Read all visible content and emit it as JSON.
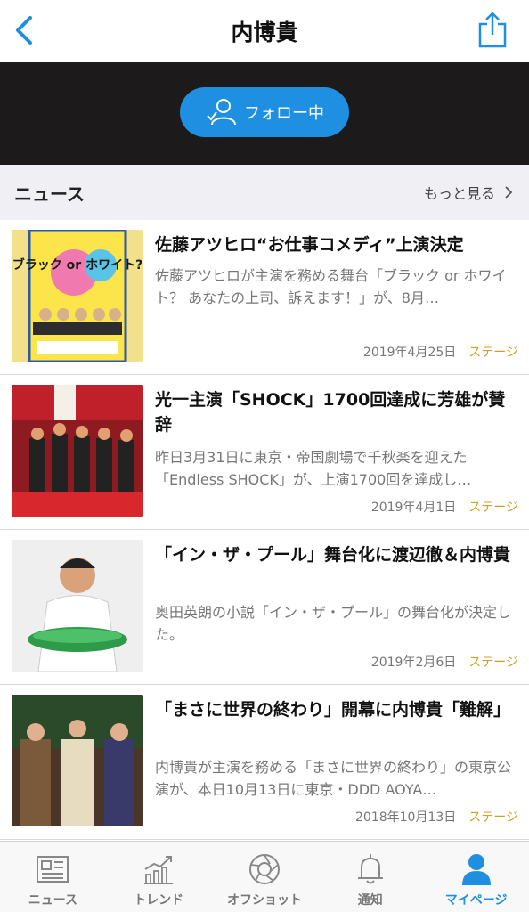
{
  "header": {
    "title": "内博貴"
  },
  "follow": {
    "label": "フォロー中"
  },
  "news_section": {
    "label": "ニュース",
    "more": "もっと見る"
  },
  "articles": [
    {
      "title": "佐藤アツヒロ“お仕事コメディ”上演決定",
      "desc": "佐藤アツヒロが主演を務める舞台「ブラック or ホワイト？ あなたの上司、訴えます！」が、8月…",
      "date": "2019年4月25日",
      "category": "ステージ",
      "thumb_text": "ブラック or ホワイト?"
    },
    {
      "title": "光一主演「SHOCK」1700回達成に芳雄が賛辞",
      "desc": "昨日3月31日に東京・帝国劇場で千秋楽を迎えた「Endless SHOCK」が、上演1700回を達成し…",
      "date": "2019年4月1日",
      "category": "ステージ"
    },
    {
      "title": "「イン・ザ・プール」舞台化に渡辺徹＆内博貴",
      "desc": "奥田英朗の小説「イン・ザ・プール」の舞台化が決定した。",
      "date": "2019年2月6日",
      "category": "ステージ"
    },
    {
      "title": "「まさに世界の終わり」開幕に内博貴「難解」",
      "desc": "内博貴が主演を務める「まさに世界の終わり」の東京公演が、本日10月13日に東京・DDD AOYA…",
      "date": "2018年10月13日",
      "category": "ステージ"
    }
  ],
  "tabs": [
    {
      "label": "ニュース",
      "icon": "news-icon"
    },
    {
      "label": "トレンド",
      "icon": "trend-icon"
    },
    {
      "label": "オフショット",
      "icon": "camera-aperture-icon"
    },
    {
      "label": "通知",
      "icon": "bell-icon"
    },
    {
      "label": "マイページ",
      "icon": "person-icon",
      "active": true
    }
  ],
  "colors": {
    "accent": "#1e8fe1",
    "category": "#c9a227",
    "hero_bg": "#1c1a1a"
  }
}
